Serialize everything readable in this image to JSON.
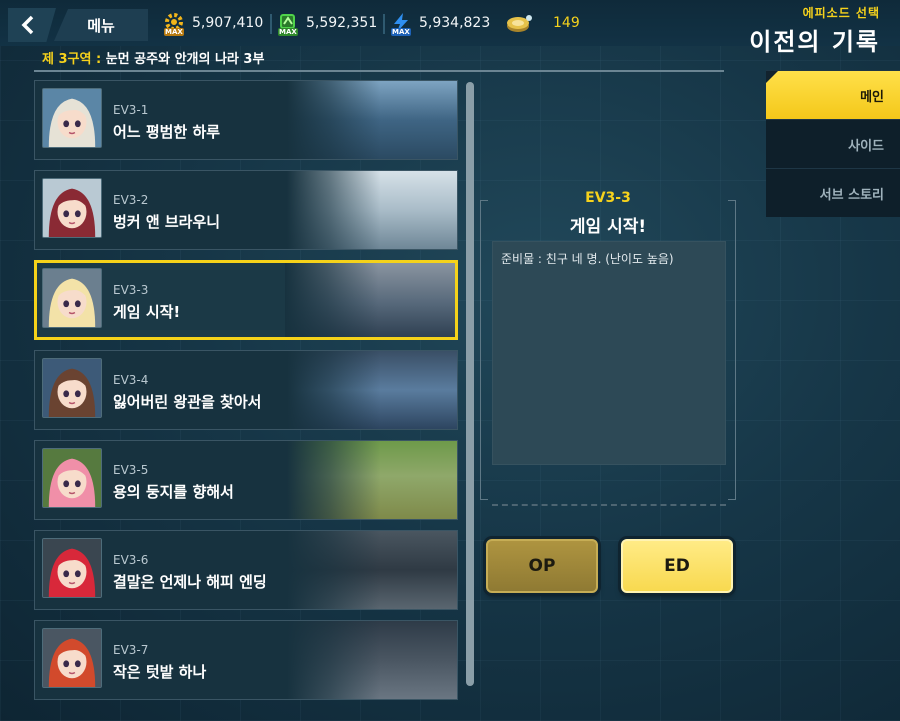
{
  "header": {
    "menu_label": "메뉴",
    "resources": [
      {
        "icon": "gear-max-icon",
        "value": "5,907,410",
        "badge": "MAX",
        "color": "#f2b51a"
      },
      {
        "icon": "chip-max-icon",
        "value": "5,592,351",
        "badge": "MAX",
        "color": "#4fd34a"
      },
      {
        "icon": "bolt-max-icon",
        "value": "5,934,823",
        "badge": "MAX",
        "color": "#2f8ff0"
      },
      {
        "icon": "gold-coin-icon",
        "value": "149",
        "color": "#f6d21c"
      }
    ],
    "subtitle": "에피소드 선택",
    "title": "이전의 기록"
  },
  "zone": {
    "label": "제 3구역 :",
    "name": "눈먼 공주와 안개의 나라 3부"
  },
  "episodes": [
    {
      "code": "EV3-1",
      "name": "어느 평범한 하루",
      "portrait": "white-haired-girl-portrait",
      "hair": "#e6e2d6",
      "bg": "#5b86a6"
    },
    {
      "code": "EV3-2",
      "name": "벙커 앤 브라우니",
      "portrait": "red-hat-girl-portrait",
      "hair": "#8a2a34",
      "bg": "#b9c9d3"
    },
    {
      "code": "EV3-3",
      "name": "게임 시작!",
      "portrait": "blonde-girl-portrait",
      "hair": "#f3e2a8",
      "bg": "#6b7f8f"
    },
    {
      "code": "EV3-4",
      "name": "잃어버린 왕관을 찾아서",
      "portrait": "brunette-girl-portrait",
      "hair": "#6a4331",
      "bg": "#3d5a78"
    },
    {
      "code": "EV3-5",
      "name": "용의 둥지를 향해서",
      "portrait": "pink-haired-girl-portrait",
      "hair": "#f08fa8",
      "bg": "#567a3f"
    },
    {
      "code": "EV3-6",
      "name": "결말은 언제나 해피 엔딩",
      "portrait": "red-haired-girl-portrait",
      "hair": "#d8283a",
      "bg": "#3a4650"
    },
    {
      "code": "EV3-7",
      "name": "작은 텃밭 하나",
      "portrait": "ginger-girl-portrait",
      "hair": "#d24a2c",
      "bg": "#4a5662"
    }
  ],
  "selected_index": 2,
  "detail": {
    "code": "EV3-3",
    "name": "게임 시작!",
    "description": "준비물 : 친구 네 명. (난이도 높음)"
  },
  "buttons": {
    "op_label": "OP",
    "ed_label": "ED"
  },
  "tabs": [
    {
      "label": "메인",
      "active": true
    },
    {
      "label": "사이드",
      "active": false
    },
    {
      "label": "서브 스토리",
      "active": false
    }
  ]
}
